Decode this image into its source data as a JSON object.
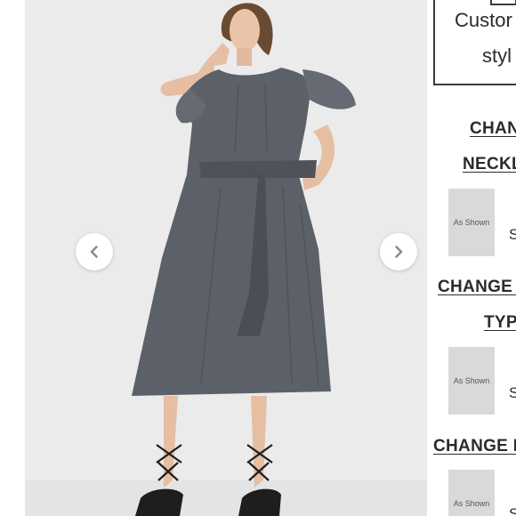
{
  "gallery": {
    "prev_icon": "chevron-left-icon",
    "next_icon": "chevron-right-icon"
  },
  "panel": {
    "custom_line_1": "Custor",
    "custom_line_2": "styl",
    "sections": [
      {
        "head_line_1": "CHAN",
        "head_line_2": "NECKL",
        "thumb_label": "As Shown",
        "option_letter": "S"
      },
      {
        "head_line_1": "CHANGE S",
        "head_line_2": "TYP",
        "thumb_label": "As Shown",
        "option_letter": "S"
      },
      {
        "head_line_1": "CHANGE L",
        "thumb_label": "As Shown",
        "option_letter": "S"
      }
    ]
  },
  "colors": {
    "gallery_bg": "#ebebeb",
    "dress": "#5c6068",
    "text": "#2b2b2b"
  }
}
